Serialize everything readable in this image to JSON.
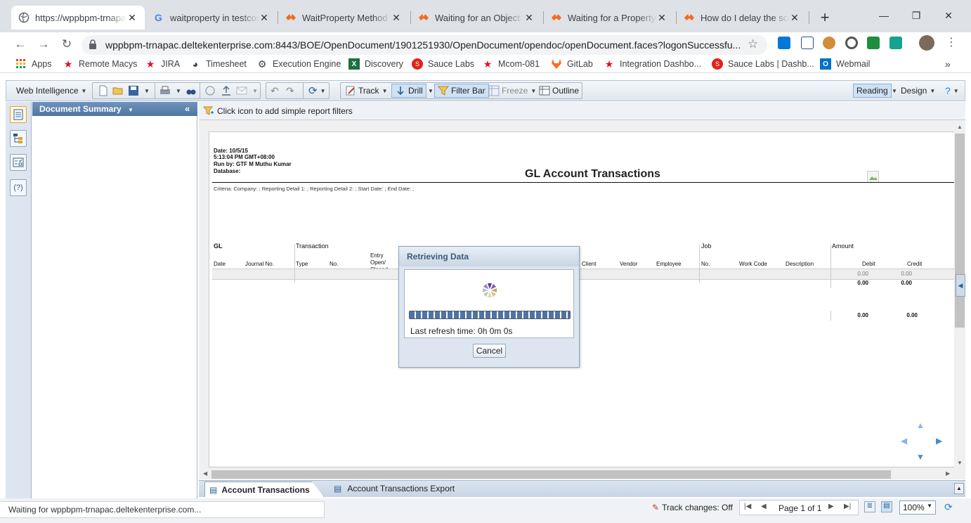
{
  "browser": {
    "tabs": [
      {
        "title": "https://wppbpm-trnapac.deltekenterprise.com",
        "icon": "globe-icon",
        "active": true
      },
      {
        "title": "waitproperty in testcomplete",
        "icon": "google-icon"
      },
      {
        "title": "WaitProperty Method | TestComplete",
        "icon": "smartbear-icon"
      },
      {
        "title": "Waiting for an Object to Appear",
        "icon": "smartbear-icon"
      },
      {
        "title": "Waiting for a Property Value",
        "icon": "smartbear-icon"
      },
      {
        "title": "How do I delay the script",
        "icon": "smartbear-icon"
      }
    ],
    "url": "wppbpm-trnapac.deltekenterprise.com:8443/BOE/OpenDocument/1901251930/OpenDocument/opendoc/openDocument.faces?logonSuccessfu...",
    "bookmarks": [
      {
        "label": "Apps",
        "icon": "apps-grid-icon"
      },
      {
        "label": "Remote Macys",
        "icon": "red-star-icon"
      },
      {
        "label": "JIRA",
        "icon": "red-star-icon"
      },
      {
        "label": "Timesheet",
        "icon": "globe-icon"
      },
      {
        "label": "Execution Engine",
        "icon": "gear-icon"
      },
      {
        "label": "Discovery",
        "icon": "excel-icon"
      },
      {
        "label": "Sauce Labs",
        "icon": "sauce-icon"
      },
      {
        "label": "Mcom-081",
        "icon": "red-star-icon"
      },
      {
        "label": "GitLab",
        "icon": "gitlab-icon"
      },
      {
        "label": "Integration Dashbo...",
        "icon": "red-star-icon"
      },
      {
        "label": "Sauce Labs | Dashb...",
        "icon": "sauce-icon"
      },
      {
        "label": "Webmail",
        "icon": "outlook-icon"
      }
    ],
    "bookmarks_overflow": "»",
    "status": "Waiting for wppbpm-trnapac.deltekenterprise.com..."
  },
  "toolbar": {
    "app_menu": "Web Intelligence",
    "track": "Track",
    "drill": "Drill",
    "filter_bar": "Filter Bar",
    "freeze": "Freeze",
    "outline": "Outline",
    "reading": "Reading",
    "design": "Design"
  },
  "doc_summary": {
    "title": "Document Summary",
    "collapse": "«"
  },
  "filter_bar": {
    "hint": "Click icon to add simple report filters"
  },
  "report": {
    "date": "Date: 10/5/15",
    "time": "5:13:04 PM GMT+08:00",
    "run_by": "Run by: GTF M Muthu Kumar",
    "database": "Database:",
    "title": "GL Account Transactions",
    "criteria": "Criteria: Company: ; Reporting Detail 1: ; Reporting Detail 2: ; Start Date: ; End Date: ;",
    "group_headers": {
      "gl": "GL",
      "transaction": "Transaction",
      "job": "Job",
      "amount": "Amount"
    },
    "columns": {
      "date": "Date",
      "journal_no": "Journal No.",
      "type": "Type",
      "no": "No.",
      "entry": "Entry",
      "open": "Open/",
      "closed": "Closed",
      "client": "Client",
      "vendor": "Vendor",
      "employee": "Employee",
      "job_no": "No.",
      "work_code": "Work Code",
      "description": "Description",
      "debit": "Debit",
      "credit": "Credit"
    },
    "row1": {
      "debit": "0.00",
      "credit": "0.00"
    },
    "row2": {
      "debit": "0.00",
      "credit": "0.00"
    },
    "total": {
      "debit": "0.00",
      "credit": "0.00"
    }
  },
  "dialog": {
    "title": "Retrieving Data",
    "refresh": "Last refresh time: 0h 0m 0s",
    "cancel": "Cancel"
  },
  "report_tabs": [
    {
      "label": "Account Transactions",
      "active": true
    },
    {
      "label": "Account Transactions Export"
    }
  ],
  "footer": {
    "track_changes": "Track changes: Off",
    "page": "Page 1 of 1",
    "zoom": "100%"
  }
}
